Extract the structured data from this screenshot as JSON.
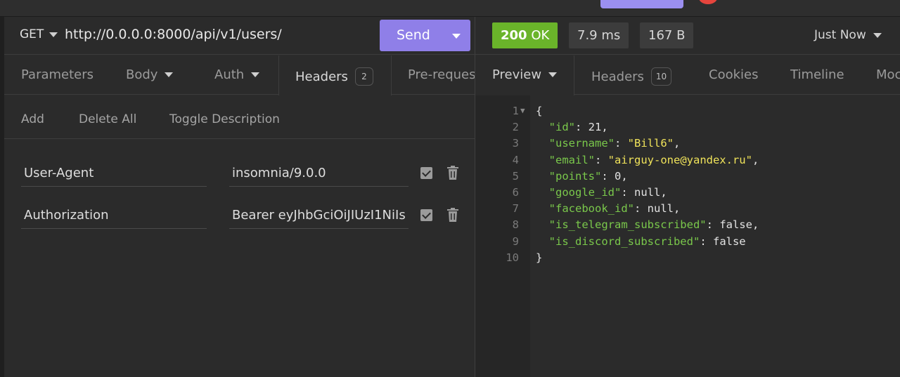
{
  "request": {
    "method": "GET",
    "url": "http://0.0.0.0:8000/api/v1/users/",
    "send_label": "Send",
    "tabs": [
      {
        "label": "Parameters"
      },
      {
        "label": "Body"
      },
      {
        "label": "Auth"
      },
      {
        "label": "Headers",
        "badge": "2"
      },
      {
        "label": "Pre-reques"
      }
    ],
    "header_actions": {
      "add": "Add",
      "delete_all": "Delete All",
      "toggle_description": "Toggle Description"
    },
    "headers": [
      {
        "name": "User-Agent",
        "value": "insomnia/9.0.0",
        "enabled": true
      },
      {
        "name": "Authorization",
        "value": "Bearer eyJhbGciOiJIUzI1NiIs",
        "enabled": true
      }
    ]
  },
  "response": {
    "status_code": "200",
    "status_text": "OK",
    "time": "7.9 ms",
    "size": "167 B",
    "history_label": "Just Now",
    "tabs": [
      {
        "label": "Preview"
      },
      {
        "label": "Headers",
        "badge": "10"
      },
      {
        "label": "Cookies"
      },
      {
        "label": "Timeline"
      },
      {
        "label": "Moc"
      }
    ],
    "line_numbers": [
      "1",
      "2",
      "3",
      "4",
      "5",
      "6",
      "7",
      "8",
      "9",
      "10"
    ],
    "body": {
      "open": "{",
      "close": "}",
      "fields": [
        {
          "key": "\"id\"",
          "value": "21,",
          "type": "plain"
        },
        {
          "key": "\"username\"",
          "value": "\"Bill6\"",
          "type": "string",
          "trail": ","
        },
        {
          "key": "\"email\"",
          "value": "\"airguy-one@yandex.ru\"",
          "type": "string",
          "trail": ","
        },
        {
          "key": "\"points\"",
          "value": "0,",
          "type": "plain"
        },
        {
          "key": "\"google_id\"",
          "value": "null,",
          "type": "plain"
        },
        {
          "key": "\"facebook_id\"",
          "value": "null,",
          "type": "plain"
        },
        {
          "key": "\"is_telegram_subscribed\"",
          "value": "false,",
          "type": "plain"
        },
        {
          "key": "\"is_discord_subscribed\"",
          "value": "false",
          "type": "plain"
        }
      ]
    }
  },
  "colors": {
    "accent": "#8f7fe8",
    "status_ok": "#6ab42a",
    "json_key": "#7ac84b",
    "json_string": "#f0e35a"
  }
}
